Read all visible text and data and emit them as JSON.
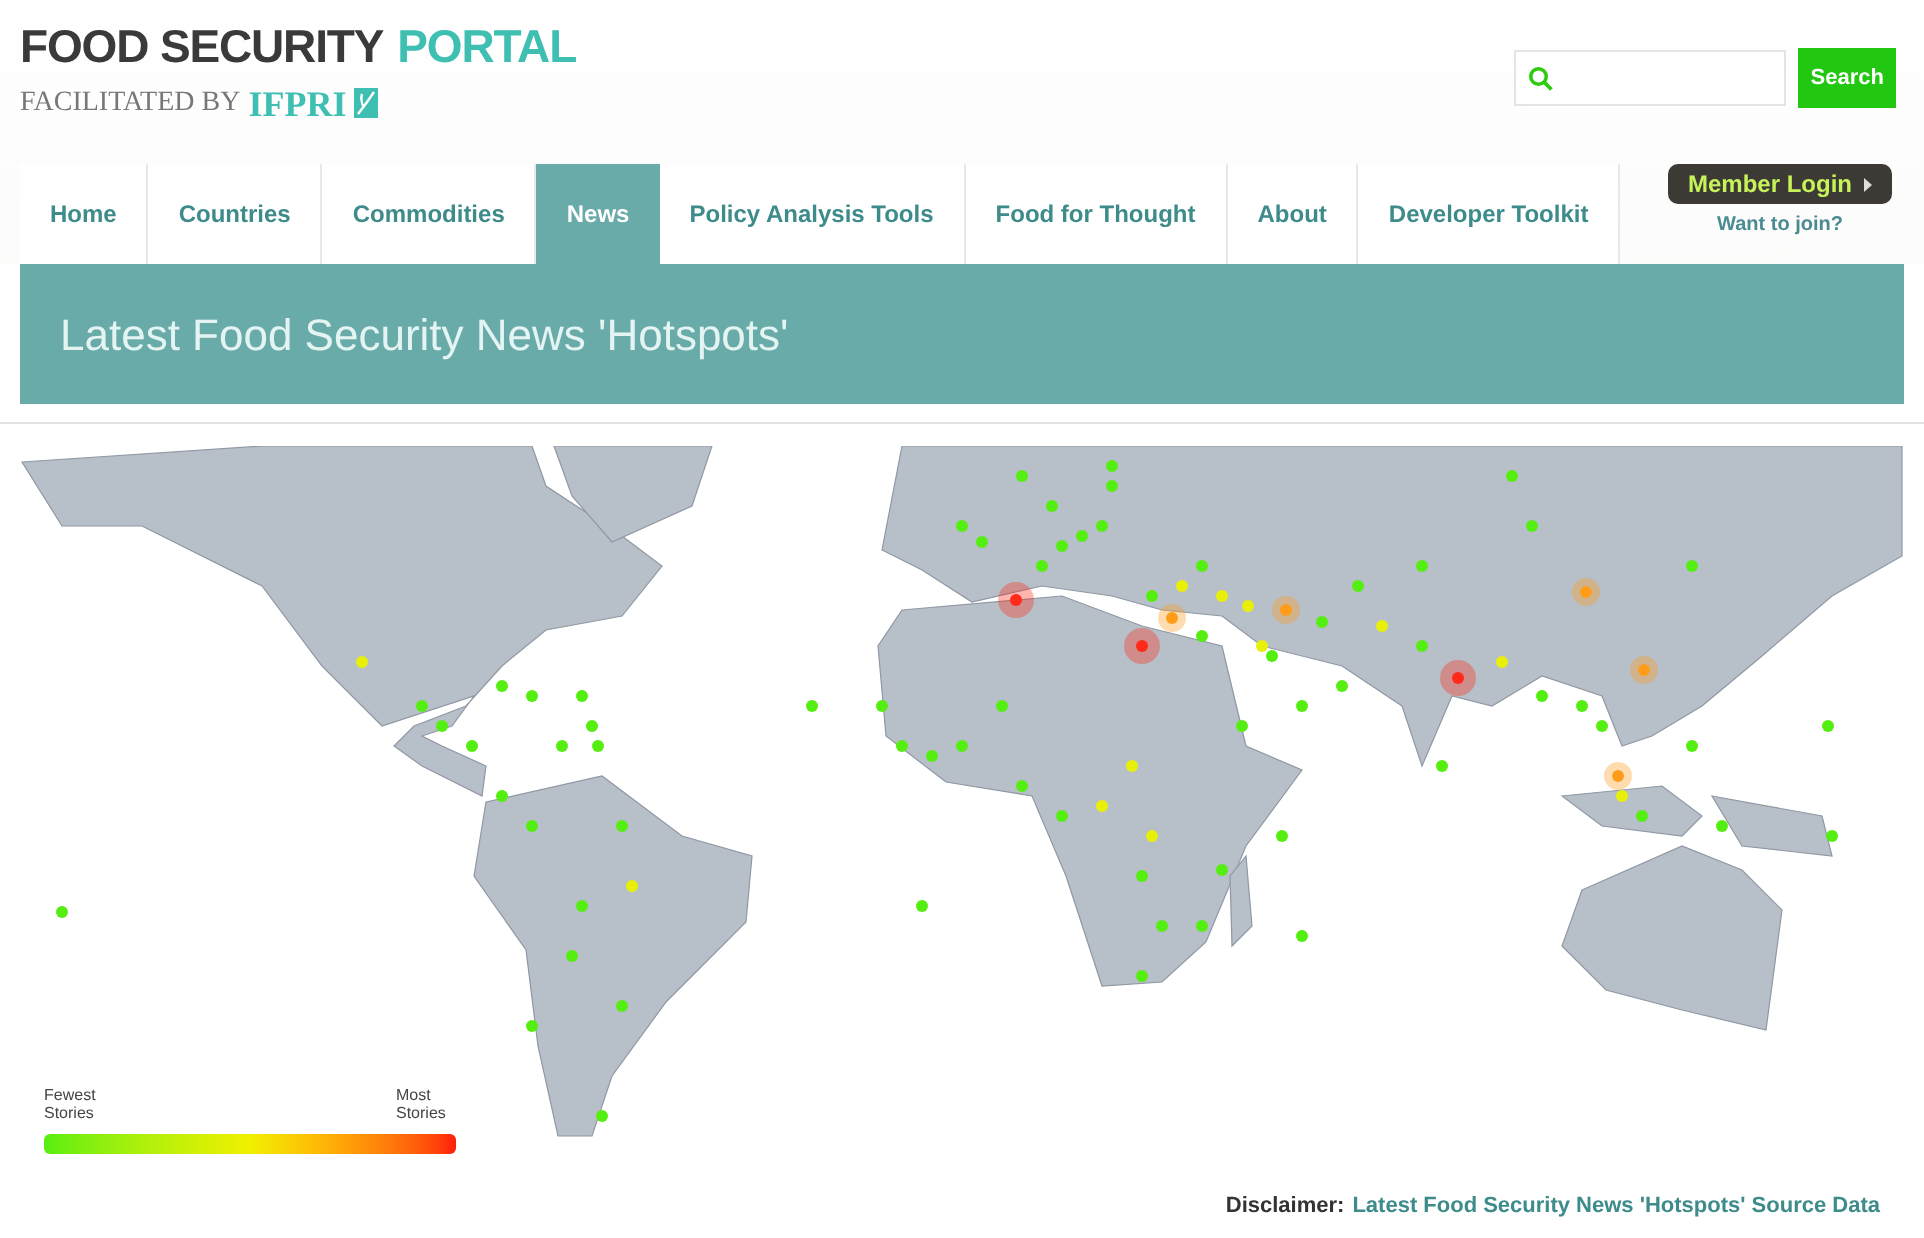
{
  "header": {
    "title": "FOOD SECURITY",
    "title_accent": "PORTAL",
    "tagline": "FACILITATED BY",
    "tagline_brand": "IFPRI"
  },
  "search": {
    "button": "Search"
  },
  "member": {
    "login": "Member Login",
    "join": "Want to join?"
  },
  "tabs": [
    {
      "label": "Home",
      "selected": false
    },
    {
      "label": "Countries",
      "selected": false
    },
    {
      "label": "Commodities",
      "selected": false
    },
    {
      "label": "News",
      "selected": true
    },
    {
      "label": "Policy Analysis Tools",
      "selected": false
    },
    {
      "label": "Food for Thought",
      "selected": false
    },
    {
      "label": "About",
      "selected": false
    },
    {
      "label": "Developer Toolkit",
      "selected": false
    }
  ],
  "banner": {
    "title": "Latest Food Security News 'Hotspots'"
  },
  "legend": {
    "low": "Fewest Stories",
    "high": "Most Stories"
  },
  "disclaimer": {
    "label": "Disclaimer:",
    "link": "Latest Food Security News 'Hotspots' Source Data"
  }
}
